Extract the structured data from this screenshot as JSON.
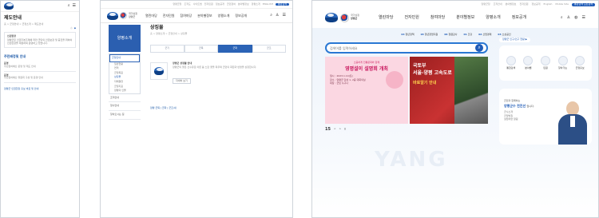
{
  "mobile": {
    "title": "제도안내",
    "breadcrumb": "홈 > 군정안내 > 군정소개 > 제도안내",
    "section_heading": "인권헌장",
    "body_text": "양평군은 인권기본조례에 따라 군민의 인권보장 및 증진을 위하여 인권헌장을 제정하여 운영하고 있습니다.",
    "plus_section": "주민배정및 안내",
    "list_items": [
      {
        "title": "운영",
        "desc": "주민참여예산 운영 및 제도 안내"
      },
      {
        "title": "운영",
        "desc": "주민참여예산 위원회 구성 및 운영 안내"
      }
    ],
    "bottom_link": "양평군 인권헌장 홍보 바로 및 안내"
  },
  "tablet": {
    "utility_links": [
      "양평군청",
      "조직도",
      "사이트맵",
      "전자민원",
      "정보공개",
      "군민참여",
      "분야별정보",
      "양평소개",
      "ENGLISH"
    ],
    "utility_button": "통합검색",
    "logo_text": "국가상징\n양평군",
    "nav": [
      "열린마당",
      "전자민원",
      "참여마당",
      "분야별정보",
      "양평소개",
      "정보공개"
    ],
    "side_title": "양평소개",
    "side_menu": [
      "군정안내",
      "일반현황",
      "연혁",
      "군정목표",
      "상징물",
      "자매결연",
      "군정지표",
      "양평의 인물"
    ],
    "side_sub": [
      "조직안내",
      "청사안내",
      "찾아오시는 길"
    ],
    "page_title": "상징물",
    "breadcrumb": "홈 > 양평소개 > 군정안내 > 상징물",
    "tabs": [
      "군기",
      "군목",
      "군화",
      "군조",
      "캐릭터"
    ],
    "active_tab": 2,
    "content_heading": "양평군 상징물 안내",
    "content_text": "양평군의 꽃은 산수유로 이른 봄 노란 꽃을 피우며 군민의 화합과 번영을 상징합니다.",
    "content_button": "자세히 보기",
    "footer_links": "양평 군목 | 군화 | 군조/새"
  },
  "main": {
    "logo_lines": [
      "국가상징",
      "양평군"
    ],
    "utility_links": [
      "양평군청",
      "조직안내",
      "분야별정보",
      "전자민원",
      "정보공개",
      "English",
      "Mobile Site"
    ],
    "utility_button": "통합검색 모든검색",
    "nav": [
      "열린마당",
      "전자민원",
      "참여마당",
      "분야별정보",
      "양평소개",
      "정보공개"
    ],
    "quick_numbers": [
      {
        "num": "04",
        "label": "청년정책"
      },
      {
        "num": "03",
        "label": "청년창업지원"
      },
      {
        "num": "06",
        "label": "청렴감사"
      },
      {
        "num": "01",
        "label": "건강"
      },
      {
        "num": "02",
        "label": "산업경제"
      },
      {
        "num": "03",
        "label": "소상공인"
      }
    ],
    "search_placeholder": "검색어를 입력하세요",
    "date_label": "양평군 인구/인구 현황 ▶",
    "banner_left": {
      "top": "소중하게 전통문화와 함께",
      "title": "영명설이 설명회 개최",
      "lines": [
        "일시 : 2023.1.14(토)",
        "장소 : 양평군 강상 1, 2층 대회의실",
        "대상 : 군민 누구나"
      ]
    },
    "banner_right": {
      "top": "국토부",
      "title": "서울-양평 고속도로",
      "subtitle": "바로알기 안내"
    },
    "slide_index": "15",
    "slide_controls": [
      "<",
      ">",
      "||"
    ],
    "watermark": "YANG",
    "quick_icons": [
      "통합검색",
      "분야별",
      "민원",
      "찾아가는",
      "군정홍보"
    ],
    "mayor_text_1": "군민과 함께하는",
    "mayor_name": "양평군수 전진선",
    "mayor_text_2": "입니다.",
    "mayor_links": [
      "군수소개",
      "군정방침",
      "설립하면 알림"
    ]
  }
}
